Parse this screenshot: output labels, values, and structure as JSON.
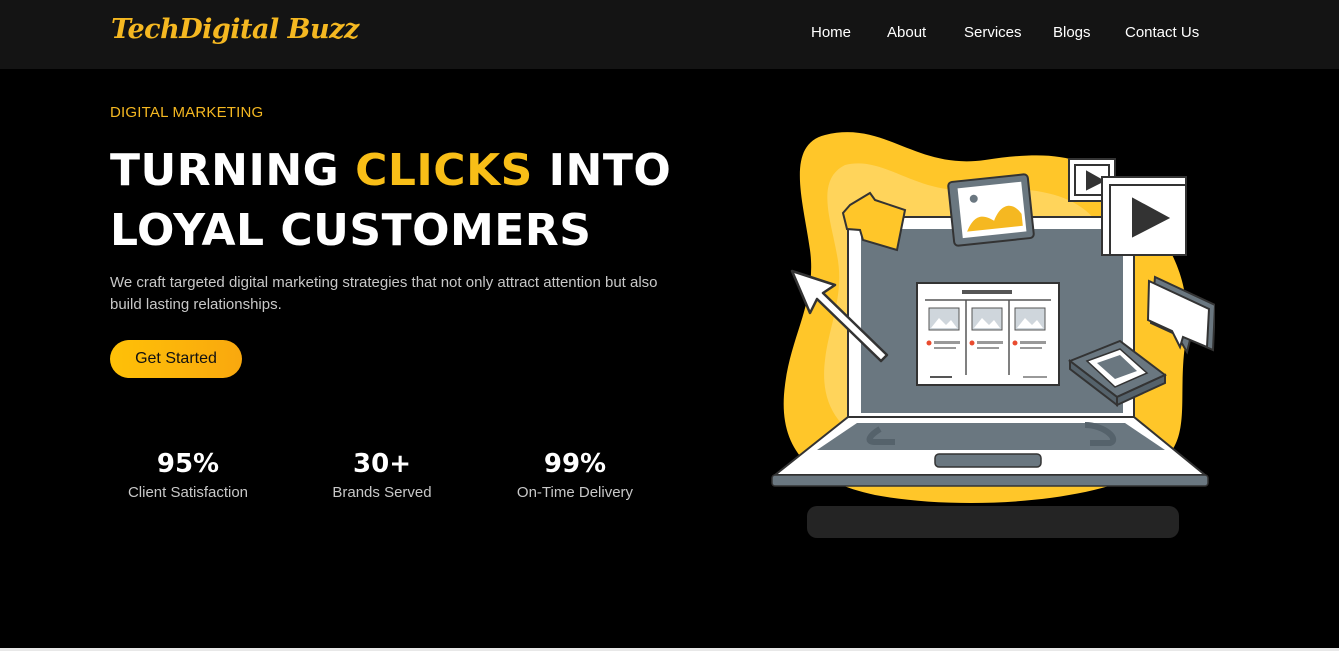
{
  "nav": {
    "logo_text": "TechDigital Buzz",
    "links": [
      {
        "label": "Home"
      },
      {
        "label": "About"
      },
      {
        "label": "Services"
      },
      {
        "label": "Blogs"
      },
      {
        "label": "Contact Us"
      }
    ]
  },
  "hero": {
    "eyebrow": "DIGITAL MARKETING",
    "headline": {
      "part1": "TURNING ",
      "accent": "CLICKS",
      "part2": " INTO",
      "line2": "LOYAL CUSTOMERS"
    },
    "description": "We craft targeted digital marketing strategies that not only attract attention but also build lasting relationships.",
    "cta_label": "Get Started"
  },
  "stats": [
    {
      "value": "95%",
      "label": "Client Satisfaction"
    },
    {
      "value": "30+",
      "label": "Brands Served"
    },
    {
      "value": "99%",
      "label": "On-Time Delivery"
    }
  ],
  "colors": {
    "accent": "#f8be17",
    "navbar_bg": "#141414",
    "page_bg": "#000000",
    "illustration_blob": "#ffc629",
    "laptop_screen": "#6a7780"
  },
  "icons": [
    "play-icon",
    "image-icon",
    "cursor-arrow-icon",
    "chat-bubble-icon",
    "keyboard-icon"
  ]
}
